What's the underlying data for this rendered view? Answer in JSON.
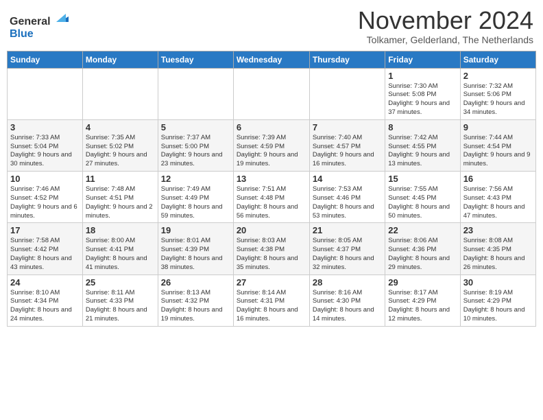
{
  "logo": {
    "general": "General",
    "blue": "Blue"
  },
  "title": "November 2024",
  "subtitle": "Tolkamer, Gelderland, The Netherlands",
  "weekdays": [
    "Sunday",
    "Monday",
    "Tuesday",
    "Wednesday",
    "Thursday",
    "Friday",
    "Saturday"
  ],
  "weeks": [
    [
      {
        "day": "",
        "info": ""
      },
      {
        "day": "",
        "info": ""
      },
      {
        "day": "",
        "info": ""
      },
      {
        "day": "",
        "info": ""
      },
      {
        "day": "",
        "info": ""
      },
      {
        "day": "1",
        "info": "Sunrise: 7:30 AM\nSunset: 5:08 PM\nDaylight: 9 hours and 37 minutes."
      },
      {
        "day": "2",
        "info": "Sunrise: 7:32 AM\nSunset: 5:06 PM\nDaylight: 9 hours and 34 minutes."
      }
    ],
    [
      {
        "day": "3",
        "info": "Sunrise: 7:33 AM\nSunset: 5:04 PM\nDaylight: 9 hours and 30 minutes."
      },
      {
        "day": "4",
        "info": "Sunrise: 7:35 AM\nSunset: 5:02 PM\nDaylight: 9 hours and 27 minutes."
      },
      {
        "day": "5",
        "info": "Sunrise: 7:37 AM\nSunset: 5:00 PM\nDaylight: 9 hours and 23 minutes."
      },
      {
        "day": "6",
        "info": "Sunrise: 7:39 AM\nSunset: 4:59 PM\nDaylight: 9 hours and 19 minutes."
      },
      {
        "day": "7",
        "info": "Sunrise: 7:40 AM\nSunset: 4:57 PM\nDaylight: 9 hours and 16 minutes."
      },
      {
        "day": "8",
        "info": "Sunrise: 7:42 AM\nSunset: 4:55 PM\nDaylight: 9 hours and 13 minutes."
      },
      {
        "day": "9",
        "info": "Sunrise: 7:44 AM\nSunset: 4:54 PM\nDaylight: 9 hours and 9 minutes."
      }
    ],
    [
      {
        "day": "10",
        "info": "Sunrise: 7:46 AM\nSunset: 4:52 PM\nDaylight: 9 hours and 6 minutes."
      },
      {
        "day": "11",
        "info": "Sunrise: 7:48 AM\nSunset: 4:51 PM\nDaylight: 9 hours and 2 minutes."
      },
      {
        "day": "12",
        "info": "Sunrise: 7:49 AM\nSunset: 4:49 PM\nDaylight: 8 hours and 59 minutes."
      },
      {
        "day": "13",
        "info": "Sunrise: 7:51 AM\nSunset: 4:48 PM\nDaylight: 8 hours and 56 minutes."
      },
      {
        "day": "14",
        "info": "Sunrise: 7:53 AM\nSunset: 4:46 PM\nDaylight: 8 hours and 53 minutes."
      },
      {
        "day": "15",
        "info": "Sunrise: 7:55 AM\nSunset: 4:45 PM\nDaylight: 8 hours and 50 minutes."
      },
      {
        "day": "16",
        "info": "Sunrise: 7:56 AM\nSunset: 4:43 PM\nDaylight: 8 hours and 47 minutes."
      }
    ],
    [
      {
        "day": "17",
        "info": "Sunrise: 7:58 AM\nSunset: 4:42 PM\nDaylight: 8 hours and 43 minutes."
      },
      {
        "day": "18",
        "info": "Sunrise: 8:00 AM\nSunset: 4:41 PM\nDaylight: 8 hours and 41 minutes."
      },
      {
        "day": "19",
        "info": "Sunrise: 8:01 AM\nSunset: 4:39 PM\nDaylight: 8 hours and 38 minutes."
      },
      {
        "day": "20",
        "info": "Sunrise: 8:03 AM\nSunset: 4:38 PM\nDaylight: 8 hours and 35 minutes."
      },
      {
        "day": "21",
        "info": "Sunrise: 8:05 AM\nSunset: 4:37 PM\nDaylight: 8 hours and 32 minutes."
      },
      {
        "day": "22",
        "info": "Sunrise: 8:06 AM\nSunset: 4:36 PM\nDaylight: 8 hours and 29 minutes."
      },
      {
        "day": "23",
        "info": "Sunrise: 8:08 AM\nSunset: 4:35 PM\nDaylight: 8 hours and 26 minutes."
      }
    ],
    [
      {
        "day": "24",
        "info": "Sunrise: 8:10 AM\nSunset: 4:34 PM\nDaylight: 8 hours and 24 minutes."
      },
      {
        "day": "25",
        "info": "Sunrise: 8:11 AM\nSunset: 4:33 PM\nDaylight: 8 hours and 21 minutes."
      },
      {
        "day": "26",
        "info": "Sunrise: 8:13 AM\nSunset: 4:32 PM\nDaylight: 8 hours and 19 minutes."
      },
      {
        "day": "27",
        "info": "Sunrise: 8:14 AM\nSunset: 4:31 PM\nDaylight: 8 hours and 16 minutes."
      },
      {
        "day": "28",
        "info": "Sunrise: 8:16 AM\nSunset: 4:30 PM\nDaylight: 8 hours and 14 minutes."
      },
      {
        "day": "29",
        "info": "Sunrise: 8:17 AM\nSunset: 4:29 PM\nDaylight: 8 hours and 12 minutes."
      },
      {
        "day": "30",
        "info": "Sunrise: 8:19 AM\nSunset: 4:29 PM\nDaylight: 8 hours and 10 minutes."
      }
    ]
  ]
}
